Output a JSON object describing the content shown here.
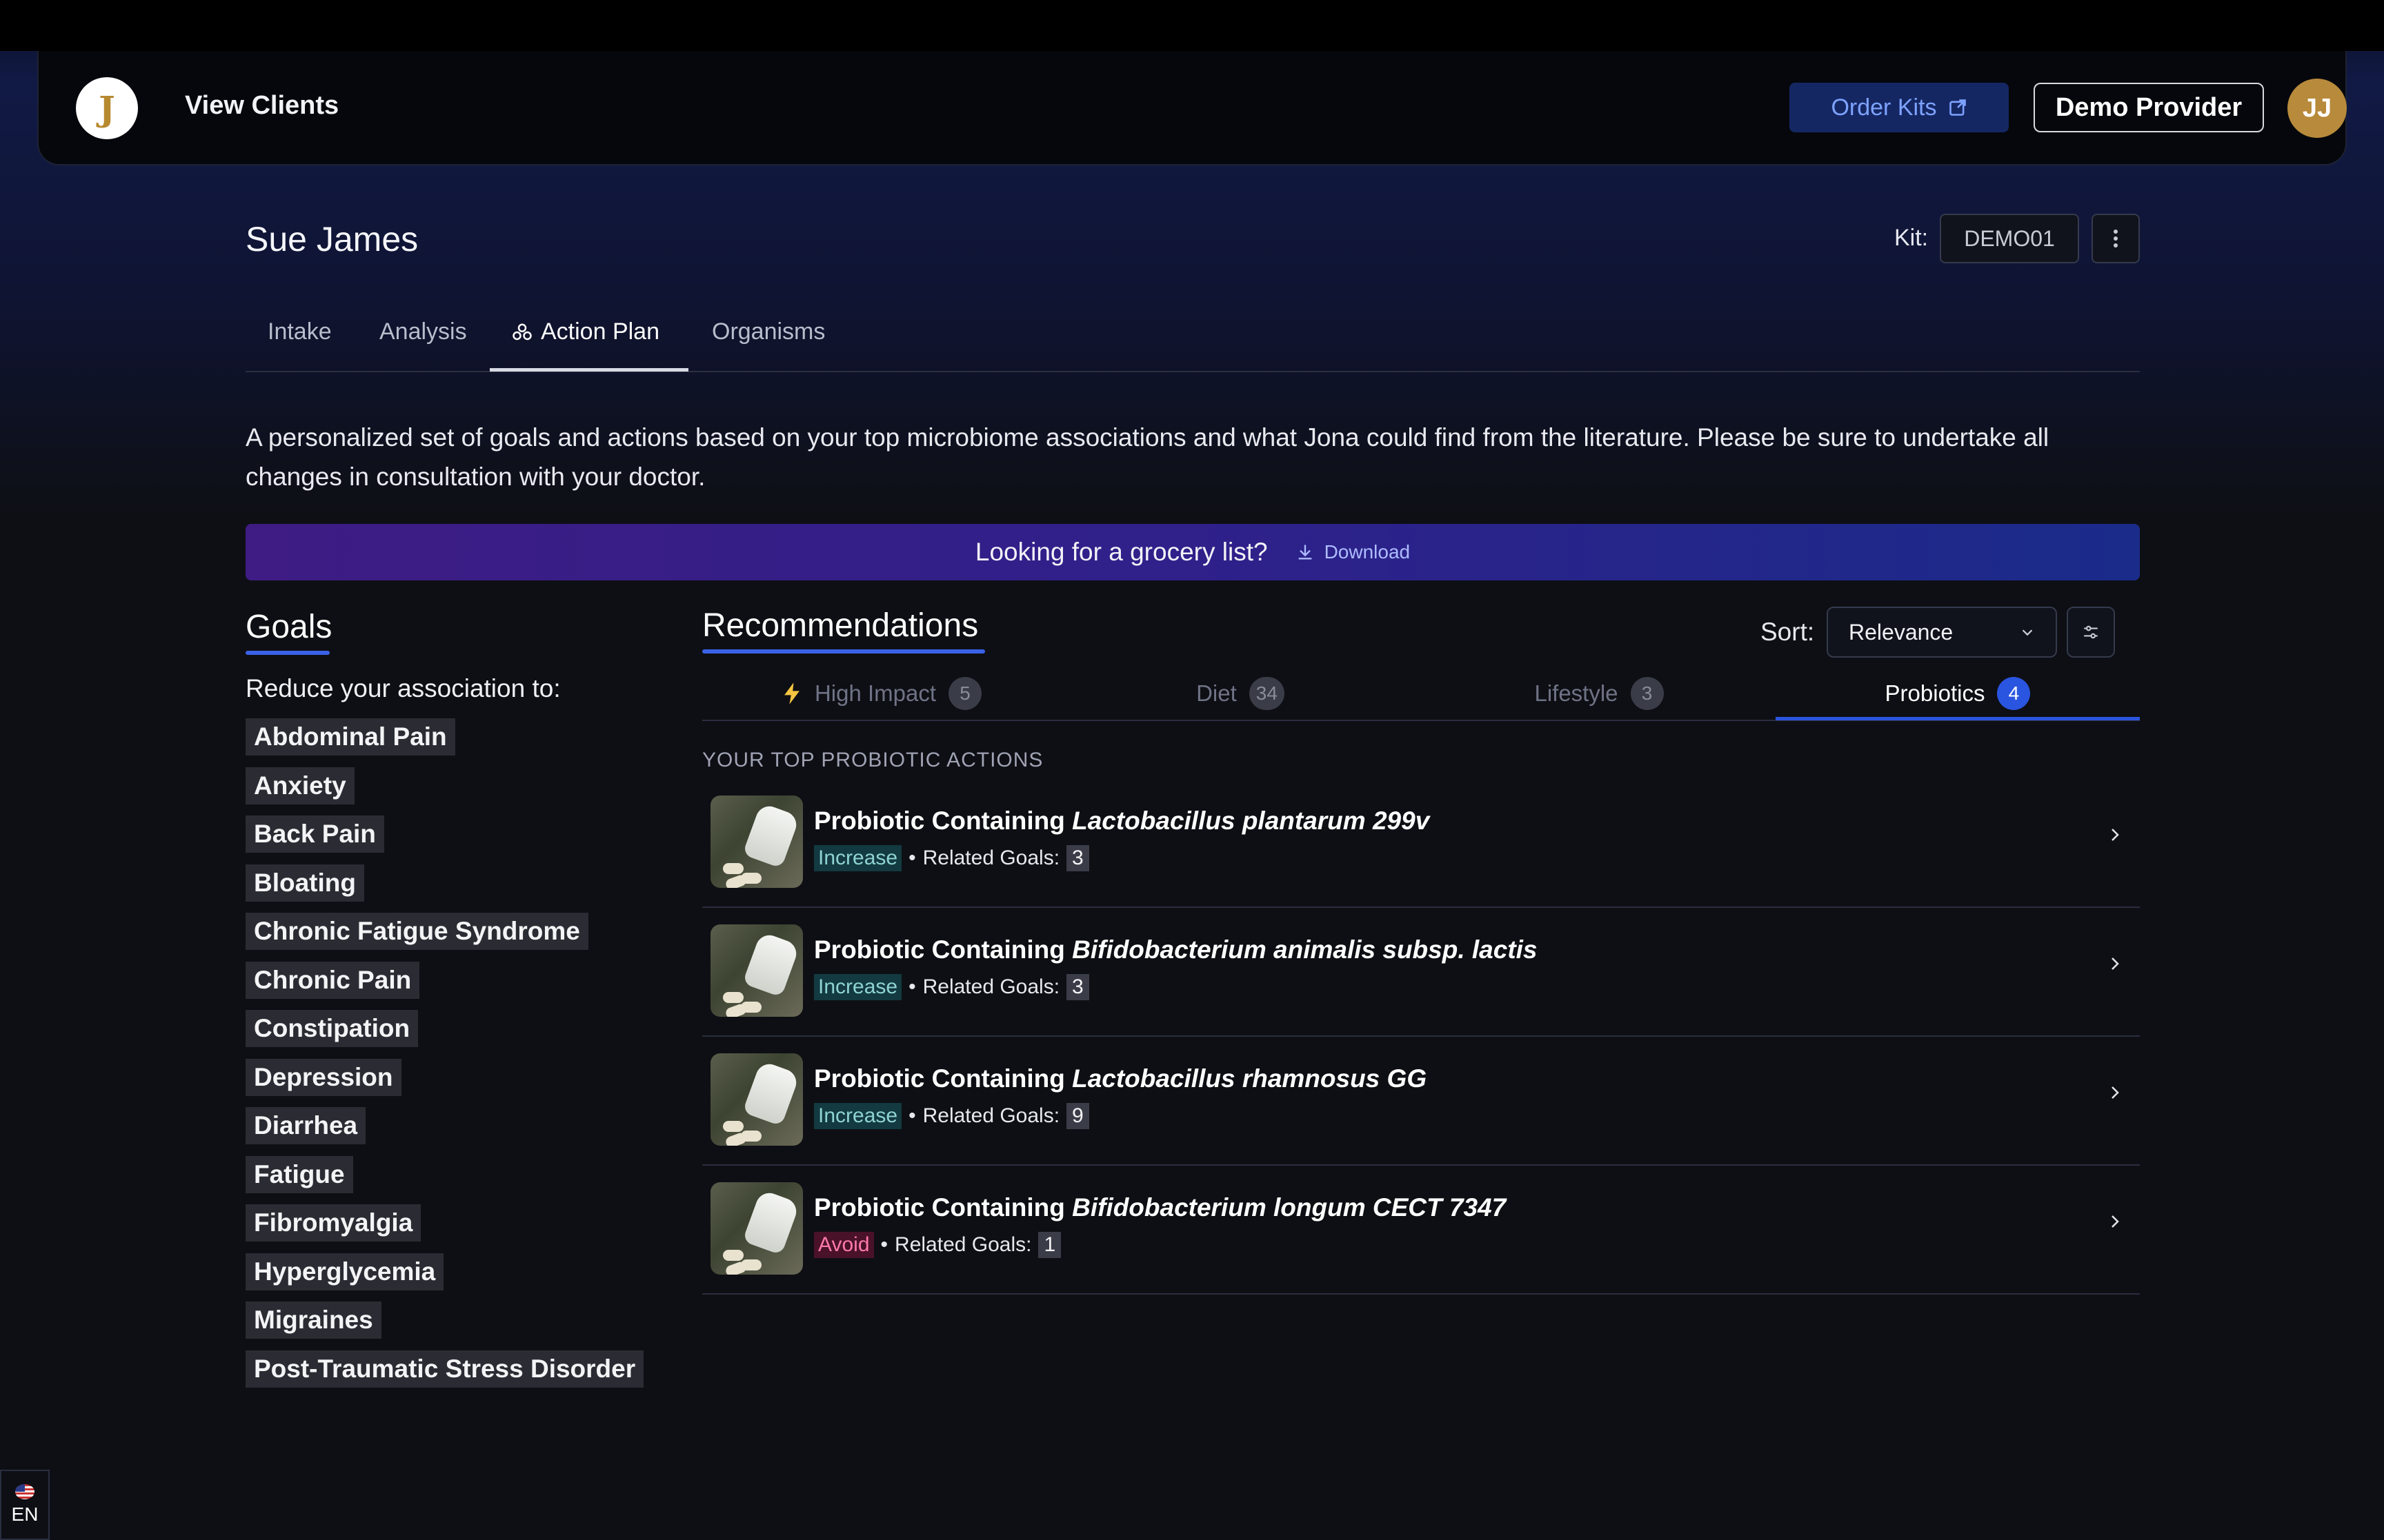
{
  "header": {
    "logo_letter": "J",
    "view_clients": "View Clients",
    "order_kits": "Order Kits",
    "provider": "Demo Provider",
    "avatar_initials": "JJ"
  },
  "client": {
    "name": "Sue James",
    "kit_label": "Kit:",
    "kit_value": "DEMO01"
  },
  "tabs": [
    {
      "label": "Intake"
    },
    {
      "label": "Analysis"
    },
    {
      "label": "Action Plan"
    },
    {
      "label": "Organisms"
    }
  ],
  "intro": "A personalized set of goals and actions based on your top microbiome associations and what Jona could find from the literature. Please be sure to undertake all changes in consultation with your doctor.",
  "banner": {
    "text": "Looking for a grocery list?",
    "download": "Download"
  },
  "goals": {
    "title": "Goals",
    "subtitle": "Reduce your association to:",
    "items": [
      "Abdominal Pain",
      "Anxiety",
      "Back Pain",
      "Bloating",
      "Chronic Fatigue Syndrome",
      "Chronic Pain",
      "Constipation",
      "Depression",
      "Diarrhea",
      "Fatigue",
      "Fibromyalgia",
      "Hyperglycemia",
      "Migraines",
      "Post-Traumatic Stress Disorder"
    ]
  },
  "recommendations": {
    "title": "Recommendations",
    "sort_label": "Sort:",
    "sort_value": "Relevance",
    "subtabs": [
      {
        "label": "High Impact",
        "count": "5"
      },
      {
        "label": "Diet",
        "count": "34"
      },
      {
        "label": "Lifestyle",
        "count": "3"
      },
      {
        "label": "Probiotics",
        "count": "4"
      }
    ],
    "section_label": "YOUR TOP PROBIOTIC ACTIONS",
    "items": [
      {
        "prefix": "Probiotic Containing ",
        "species": "Lactobacillus plantarum 299v",
        "tag": "Increase",
        "related_label": "Related Goals:",
        "related": "3"
      },
      {
        "prefix": "Probiotic Containing ",
        "species": "Bifidobacterium animalis subsp. lactis",
        "tag": "Increase",
        "related_label": "Related Goals:",
        "related": "3"
      },
      {
        "prefix": "Probiotic Containing ",
        "species": "Lactobacillus rhamnosus GG",
        "tag": "Increase",
        "related_label": "Related Goals:",
        "related": "9"
      },
      {
        "prefix": "Probiotic Containing ",
        "species": "Bifidobacterium longum CECT 7347",
        "tag": "Avoid",
        "related_label": "Related Goals:",
        "related": "1"
      }
    ]
  },
  "language": "EN",
  "colors": {
    "accent": "#2a55e0",
    "increase_tag": "#8fd3d2",
    "avoid_tag": "#ff7aa8",
    "avatar": "#b88a3b"
  }
}
